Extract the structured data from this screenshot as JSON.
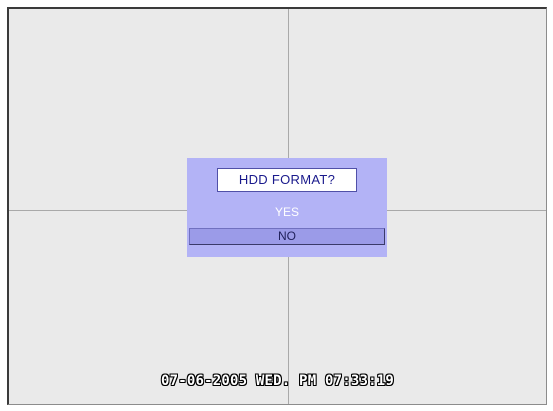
{
  "dialog": {
    "title": "HDD FORMAT?",
    "options": [
      "YES",
      "NO"
    ],
    "selected": "NO"
  },
  "osd": {
    "datetime": "07-06-2005 WED. PM 07:33:19"
  },
  "colors": {
    "screen_bg": "#eaeaea",
    "grid_line": "#a9a9a9",
    "dialog_bg": "#b3b3f6",
    "selected_bg": "#9b9be8",
    "title_text": "#1a1a8c"
  }
}
